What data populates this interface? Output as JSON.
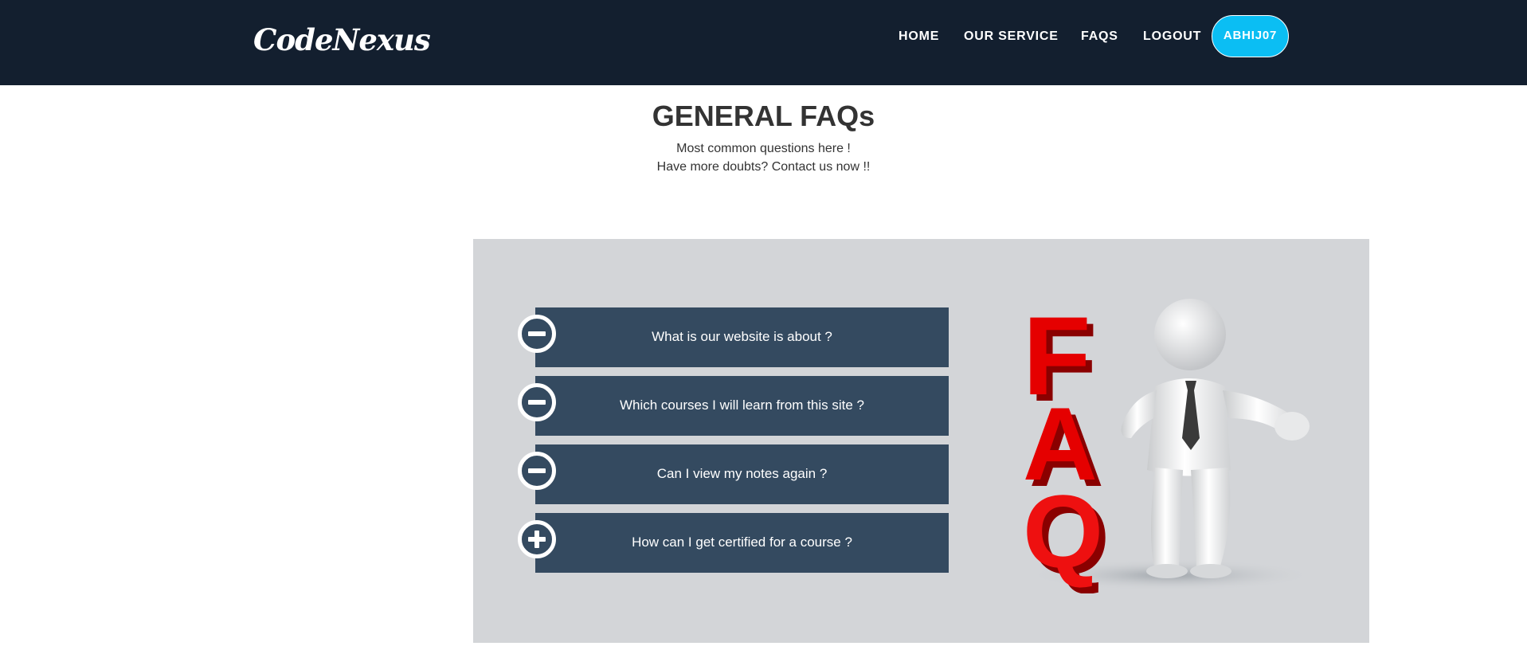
{
  "brand": {
    "logo": "CodeNexus"
  },
  "nav": {
    "items": [
      {
        "label": "HOME"
      },
      {
        "label": "OUR SERVICE"
      },
      {
        "label": "FAQS"
      },
      {
        "label": "LOGOUT"
      }
    ],
    "user_label": "ABHIJ07"
  },
  "header": {
    "title": "GENERAL FAQs",
    "subtitle_line1": "Most common questions here !",
    "subtitle_line2": "Have more doubts? Contact us now !!"
  },
  "faqs": [
    {
      "question": "What is our website is about ?",
      "state": "expanded",
      "icon": "minus-icon"
    },
    {
      "question": "Which courses I will learn from this site ?",
      "state": "expanded",
      "icon": "minus-icon"
    },
    {
      "question": "Can I view my notes again ?",
      "state": "expanded",
      "icon": "minus-icon"
    },
    {
      "question": "How can I get certified for a course ?",
      "state": "collapsed",
      "icon": "plus-icon"
    }
  ],
  "illustration": {
    "text": "FAQ"
  },
  "colors": {
    "navbar": "#131f2f",
    "accent": "#0bbef3",
    "faq_item": "#344a60",
    "panel": "#d3d5d8",
    "faq_red": "#e50000"
  }
}
